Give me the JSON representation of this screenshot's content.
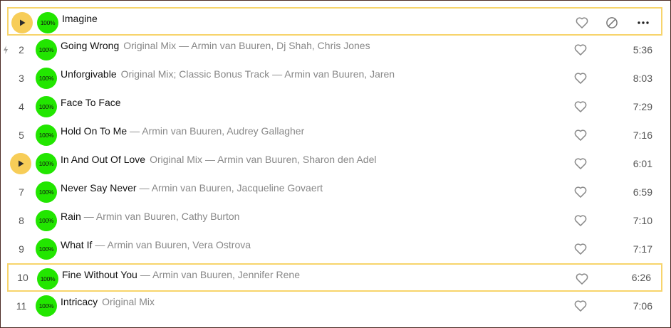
{
  "badge_text": "100%",
  "colors": {
    "highlight_border": "#f7d46b",
    "play_button": "#f7cd58",
    "badge": "#22e600",
    "muted_text": "#888888",
    "primary_text": "#111111"
  },
  "icons": {
    "play": "play-icon",
    "like": "heart-icon",
    "dislike": "block-icon",
    "more": "more-icon",
    "popular": "lightning-icon"
  },
  "tracks": [
    {
      "number": "",
      "title": "Imagine",
      "version": "",
      "artists": "",
      "duration": "",
      "state": "playing-hover"
    },
    {
      "number": "2",
      "title": "Going Wrong",
      "version": "Original Mix",
      "artists": "— Armin van Buuren, Dj Shah, Chris Jones",
      "duration": "5:36",
      "popular": true
    },
    {
      "number": "3",
      "title": "Unforgivable",
      "version": "Original Mix; Classic Bonus Track",
      "artists": "— Armin van Buuren, Jaren",
      "duration": "8:03"
    },
    {
      "number": "4",
      "title": "Face To Face",
      "version": "",
      "artists": "",
      "duration": "7:29"
    },
    {
      "number": "5",
      "title": "Hold On To Me",
      "version": "",
      "artists": "— Armin van Buuren, Audrey Gallagher",
      "duration": "7:16"
    },
    {
      "number": "",
      "title": "In And Out Of Love",
      "version": "Original Mix",
      "artists": "— Armin van Buuren, Sharon den Adel",
      "duration": "6:01",
      "state": "play-button"
    },
    {
      "number": "7",
      "title": "Never Say Never",
      "version": "",
      "artists": "— Armin van Buuren, Jacqueline Govaert",
      "duration": "6:59"
    },
    {
      "number": "8",
      "title": "Rain",
      "version": "",
      "artists": "— Armin van Buuren, Cathy Burton",
      "duration": "7:10"
    },
    {
      "number": "9",
      "title": "What If",
      "version": "",
      "artists": "— Armin van Buuren, Vera Ostrova",
      "duration": "7:17"
    },
    {
      "number": "10",
      "title": "Fine Without You",
      "version": "",
      "artists": "— Armin van Buuren, Jennifer Rene",
      "duration": "6:26",
      "state": "selected"
    },
    {
      "number": "11",
      "title": "Intricacy",
      "version": "Original Mix",
      "artists": "",
      "duration": "7:06"
    }
  ]
}
